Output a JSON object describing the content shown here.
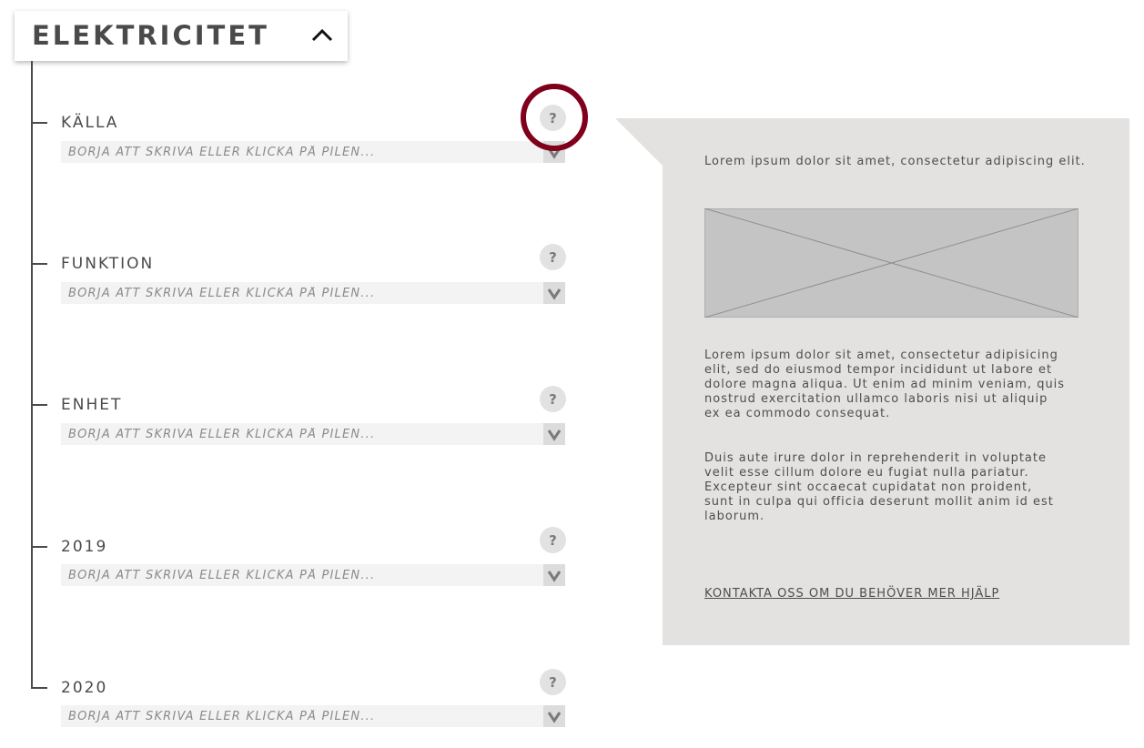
{
  "header": {
    "title": "ELEKTRICITET",
    "collapse_icon": "chevron-up-icon"
  },
  "fields": [
    {
      "label": "KÄLLA",
      "placeholder": "BÖRJA ATT SKRIVA ELLER KLICKA PÅ PILEN...",
      "help": "?"
    },
    {
      "label": "FUNKTION",
      "placeholder": "BÖRJA ATT SKRIVA ELLER KLICKA PÅ PILEN...",
      "help": "?"
    },
    {
      "label": "ENHET",
      "placeholder": "BÖRJA ATT SKRIVA ELLER KLICKA PÅ PILEN...",
      "help": "?"
    },
    {
      "label": "2019",
      "placeholder": "BÖRJA ATT SKRIVA ELLER KLICKA PÅ PILEN...",
      "help": "?"
    },
    {
      "label": "2020",
      "placeholder": "BÖRJA ATT SKRIVA ELLER KLICKA PÅ PILEN...",
      "help": "?"
    }
  ],
  "help_panel": {
    "intro": "Lorem ipsum dolor sit amet, consectetur adipiscing elit.",
    "image_icon": "image-placeholder-icon",
    "paragraph1_lines": [
      "Lorem ipsum dolor sit amet, consectetur adipisicing",
      "elit, sed do eiusmod tempor incididunt ut labore et",
      "dolore magna aliqua. Ut enim ad minim veniam, quis",
      "nostrud exercitation ullamco laboris nisi ut aliquip",
      "ex ea commodo consequat."
    ],
    "paragraph2_lines": [
      "Duis aute irure dolor in reprehenderit in voluptate",
      "velit esse cillum dolore eu fugiat nulla pariatur.",
      "Excepteur sint occaecat cupidatat non proident,",
      "sunt in culpa qui officia deserunt mollit anim id est",
      "laborum."
    ],
    "contact_link": "KONTAKTA OSS OM DU BEHÖVER MER HJÄLP"
  },
  "colors": {
    "highlight": "#80001c",
    "panel_bg": "#e3e2e0",
    "input_bg": "#f3f3f3"
  }
}
